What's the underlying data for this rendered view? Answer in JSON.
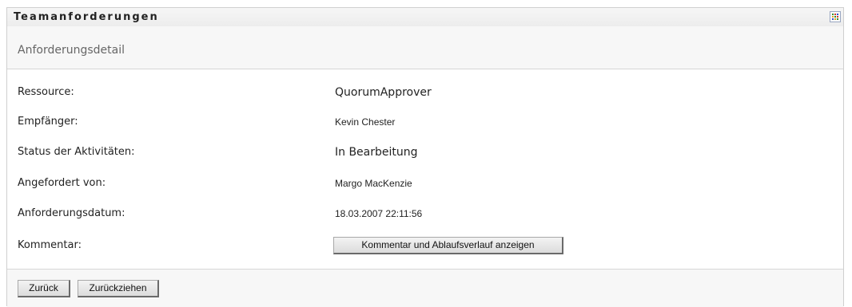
{
  "panel": {
    "title": "Teamanforderungen",
    "menu_icon": "grid-icon",
    "menu_colors": [
      "#2f8f2f",
      "#d03a2b",
      "#2f4fd0",
      "#e0a020",
      "#2f8f2f",
      "#d03a2b",
      "#2f4fd0",
      "#e0a020",
      "#2f8f2f"
    ]
  },
  "subheader": {
    "title": "Anforderungsdetail"
  },
  "details": {
    "resource_label": "Ressource:",
    "resource_value": "QuorumApprover",
    "recipient_label": "Empfänger:",
    "recipient_value": "Kevin Chester",
    "status_label": "Status der Aktivitäten:",
    "status_value": "In Bearbeitung",
    "requested_by_label": "Angefordert von:",
    "requested_by_value": "Margo MacKenzie",
    "request_date_label": "Anforderungsdatum:",
    "request_date_value": "18.03.2007 22:11:56",
    "comment_label": "Kommentar:",
    "comment_button": "Kommentar und Ablaufsverlauf anzeigen"
  },
  "footer": {
    "back_button": "Zurück",
    "withdraw_button": "Zurückziehen"
  }
}
